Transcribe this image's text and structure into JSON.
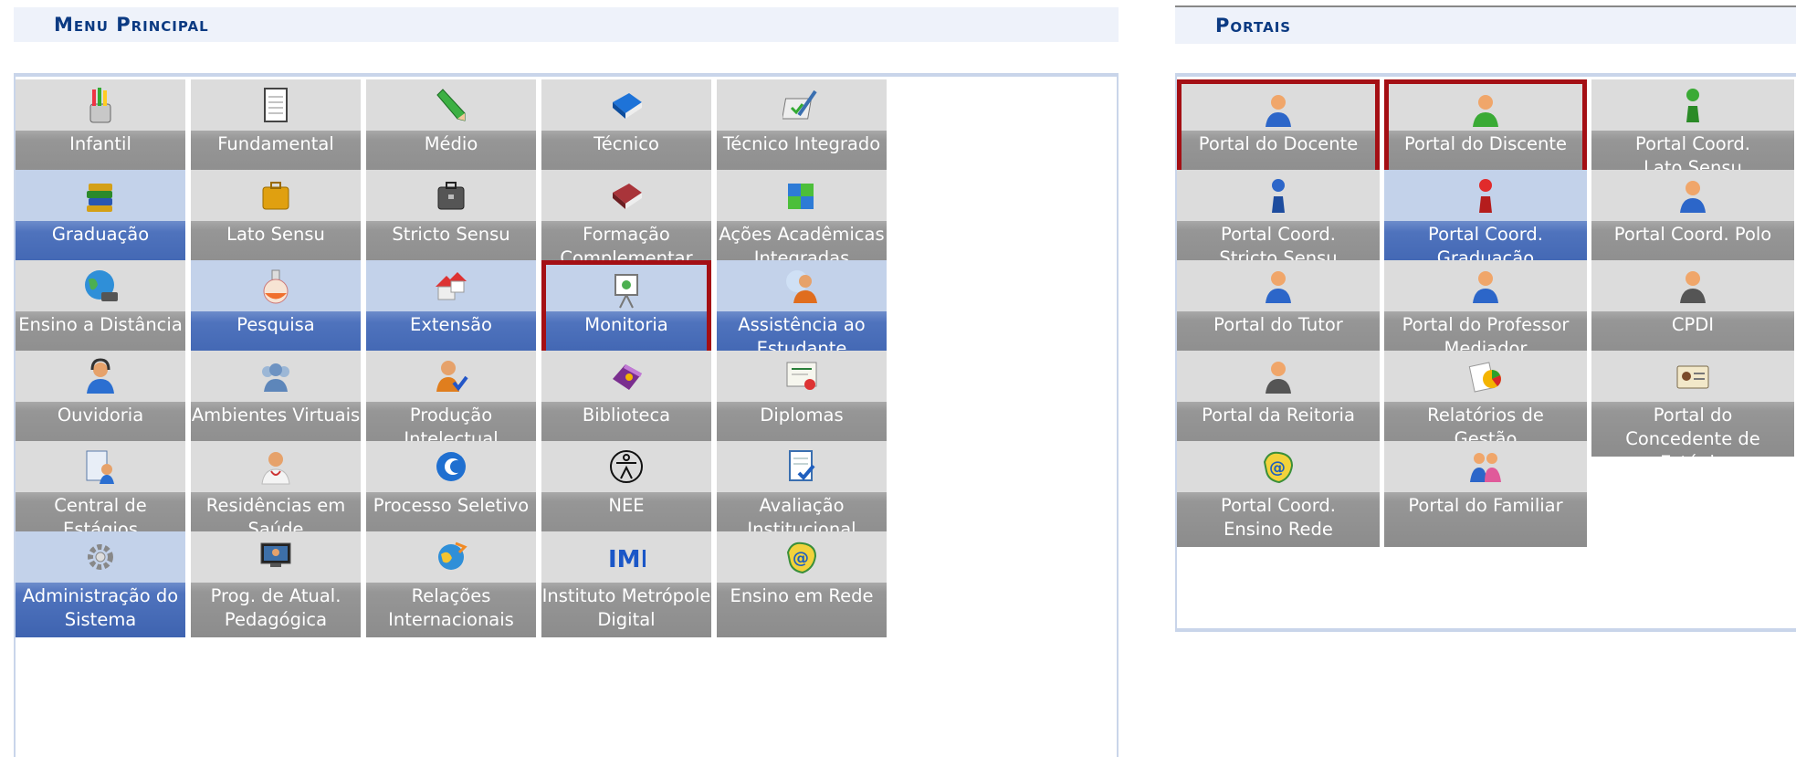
{
  "menu_title": "Menu Principal",
  "portais_title": "Portais",
  "menu": [
    {
      "label": "Infantil",
      "icon": "colored-pencils-icon",
      "style": "gray"
    },
    {
      "label": "Fundamental",
      "icon": "notebook-icon",
      "style": "gray"
    },
    {
      "label": "Médio",
      "icon": "pencil-icon",
      "style": "gray"
    },
    {
      "label": "Técnico",
      "icon": "blue-book-icon",
      "style": "gray"
    },
    {
      "label": "Técnico Integrado",
      "icon": "checklist-pen-icon",
      "style": "gray"
    },
    {
      "label": "Graduação",
      "icon": "books-stack-icon",
      "style": "blue"
    },
    {
      "label": "Lato Sensu",
      "icon": "briefcase-icon",
      "style": "gray"
    },
    {
      "label": "Stricto Sensu",
      "icon": "dark-briefcase-icon",
      "style": "gray"
    },
    {
      "label": "Formação\nComplementar",
      "icon": "red-book-icon",
      "style": "gray"
    },
    {
      "label": "Ações Acadêmicas\nIntegradas",
      "icon": "puzzle-icon",
      "style": "gray"
    },
    {
      "label": "Ensino a Distância",
      "icon": "globe-icon",
      "style": "gray"
    },
    {
      "label": "Pesquisa",
      "icon": "flask-icon",
      "style": "blue"
    },
    {
      "label": "Extensão",
      "icon": "houses-icon",
      "style": "blue"
    },
    {
      "label": "Monitoria",
      "icon": "presentation-board-icon",
      "style": "blue",
      "highlight": true
    },
    {
      "label": "Assistência ao\nEstudante",
      "icon": "person-support-icon",
      "style": "blue"
    },
    {
      "label": "Ouvidoria",
      "icon": "headset-user-icon",
      "style": "gray"
    },
    {
      "label": "Ambientes Virtuais",
      "icon": "people-group-icon",
      "style": "gray"
    },
    {
      "label": "Produção Intelectual",
      "icon": "user-check-icon",
      "style": "gray"
    },
    {
      "label": "Biblioteca",
      "icon": "book-library-icon",
      "style": "gray"
    },
    {
      "label": "Diplomas",
      "icon": "certificate-icon",
      "style": "gray"
    },
    {
      "label": "Central de Estágios",
      "icon": "user-agenda-icon",
      "style": "gray"
    },
    {
      "label": "Residências em\nSaúde",
      "icon": "doctor-icon",
      "style": "gray"
    },
    {
      "label": "Processo Seletivo",
      "icon": "c-logo-icon",
      "style": "gray"
    },
    {
      "label": "NEE",
      "icon": "accessibility-icon",
      "style": "gray"
    },
    {
      "label": "Avaliação\nInstitucional",
      "icon": "document-check-icon",
      "style": "gray"
    },
    {
      "label": "Administração do\nSistema",
      "icon": "gear-icon",
      "style": "blue"
    },
    {
      "label": "Prog. de Atual.\nPedagógica",
      "icon": "monitor-icon",
      "style": "gray"
    },
    {
      "label": "Relações\nInternacionais",
      "icon": "globe-arrows-icon",
      "style": "gray"
    },
    {
      "label": "Instituto Metrópole\nDigital",
      "icon": "imd-logo-icon",
      "style": "gray"
    },
    {
      "label": "Ensino em Rede",
      "icon": "at-map-icon",
      "style": "gray"
    }
  ],
  "portais": [
    {
      "label": "Portal do Docente",
      "icon": "user-blue-icon",
      "style": "gray",
      "highlight": true
    },
    {
      "label": "Portal do Discente",
      "icon": "user-green-icon",
      "style": "gray",
      "highlight": true
    },
    {
      "label": "Portal Coord.\nLato Sensu",
      "icon": "pawn-green-icon",
      "style": "gray"
    },
    {
      "label": "Portal Coord.\nStricto Sensu",
      "icon": "pawn-blue-icon",
      "style": "gray"
    },
    {
      "label": "Portal Coord.\nGraduação",
      "icon": "pawn-red-icon",
      "style": "blue"
    },
    {
      "label": "Portal Coord. Polo",
      "icon": "user-blue-icon",
      "style": "gray"
    },
    {
      "label": "Portal do Tutor",
      "icon": "user-blue-icon",
      "style": "gray"
    },
    {
      "label": "Portal do Professor\nMediador",
      "icon": "user-blue-icon",
      "style": "gray"
    },
    {
      "label": "CPDI",
      "icon": "user-suit-icon",
      "style": "gray"
    },
    {
      "label": "Portal da Reitoria",
      "icon": "user-suit-icon",
      "style": "gray"
    },
    {
      "label": "Relatórios de\nGestão",
      "icon": "reports-icon",
      "style": "gray"
    },
    {
      "label": "Portal do\nConcedente de\nEstágio",
      "icon": "id-card-icon",
      "style": "gray"
    },
    {
      "label": "Portal Coord.\nEnsino Rede",
      "icon": "at-map-icon",
      "style": "gray"
    },
    {
      "label": "Portal do Familiar",
      "icon": "family-icon",
      "style": "gray"
    }
  ]
}
